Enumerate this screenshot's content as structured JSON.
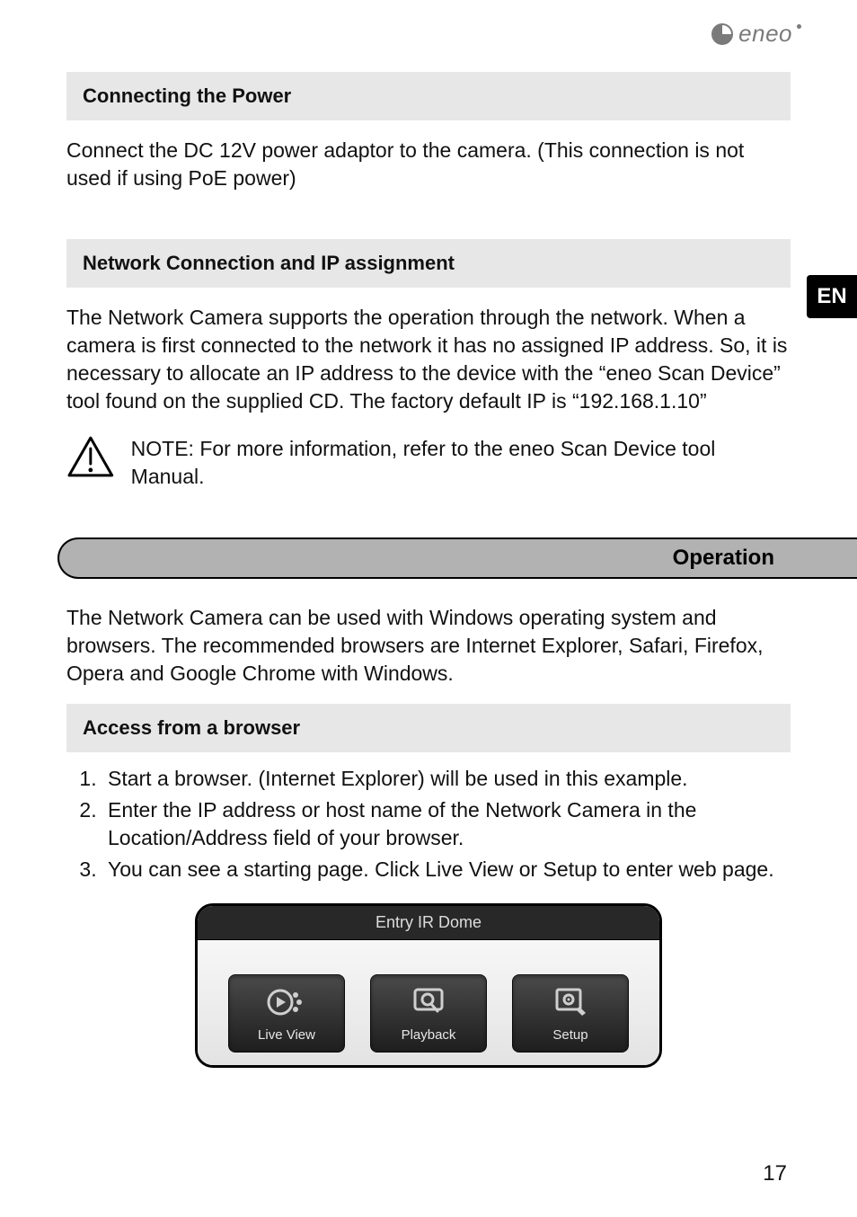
{
  "logo": {
    "text": "eneo"
  },
  "language_tab": "EN",
  "sections": {
    "power_title": "Connecting the Power",
    "power_body": "Connect the DC 12V power adaptor to the camera. (This connection is not used if using PoE power)",
    "network_title": "Network Connection and IP assignment",
    "network_body": "The Network Camera supports the operation through the network. When a camera is first connected to the network it has no assigned IP address. So, it is necessary to allocate an IP address to the device with the “eneo Scan Device” tool found on the supplied CD. The factory default IP is “192.168.1.10”",
    "note": "NOTE: For more information, refer to the eneo Scan Device tool Manual.",
    "operation_title": "Operation",
    "operation_body": "The Network Camera can be used with Windows operating system and browsers. The recommended browsers are Internet Explorer, Safari, Firefox, Opera and Google Chrome with Windows.",
    "access_title": "Access from a browser",
    "steps": [
      "Start a browser. (Internet Explorer) will be used in this example.",
      "Enter the IP address or host name of the Network Camera in the Location/Address field of your browser.",
      "You can see a starting page. Click Live View or Setup to enter web page."
    ]
  },
  "screenshot": {
    "title": "Entry IR Dome",
    "buttons": {
      "live_view": "Live View",
      "playback": "Playback",
      "setup": "Setup"
    }
  },
  "page_number": "17"
}
